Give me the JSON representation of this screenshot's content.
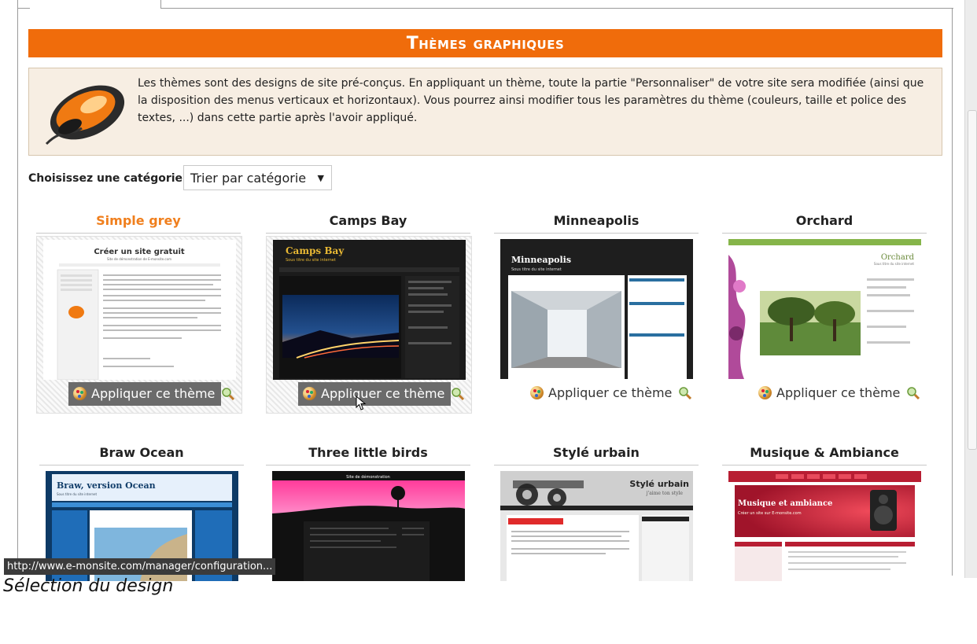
{
  "banner": {
    "title": "Thèmes graphiques"
  },
  "intro": {
    "text": "Les thèmes sont des designs de site pré-conçus. En appliquant un thème, toute la partie \"Personnaliser\" de votre site sera modifiée (ainsi que la disposition des menus verticaux et horizontaux). Vous pourrez ainsi modifier tous les paramètres du thème (couleurs, taille et police des textes, ...) dans cette partie après l'avoir appliqué."
  },
  "category": {
    "label": "Choisissez une catégorie :",
    "selected": "Trier par catégorie"
  },
  "apply_label": "Appliquer ce thème",
  "colors": {
    "accent": "#f06c0b",
    "highlight_title": "#f07f1d"
  },
  "themes": [
    {
      "name": "Simple grey",
      "preview_title": "Créer un site gratuit",
      "preview_sub": "Site de démonstration de E-monsite.com"
    },
    {
      "name": "Camps Bay",
      "preview_title": "Camps Bay",
      "preview_sub": "Sous titre du site internet"
    },
    {
      "name": "Minneapolis",
      "preview_title": "Minneapolis",
      "preview_sub": "Sous titre du site internet"
    },
    {
      "name": "Orchard",
      "preview_title": "Orchard",
      "preview_sub": "Sous titre du site internet"
    },
    {
      "name": "Braw Ocean",
      "preview_title": "Braw, version Ocean",
      "preview_sub": "Sous titre du site internet"
    },
    {
      "name": "Three little birds",
      "preview_title": "Site de démonstration",
      "preview_sub": ""
    },
    {
      "name": "Stylé urbain",
      "preview_title": "Stylé urbain",
      "preview_sub": "j'aime ton style"
    },
    {
      "name": "Musique & Ambiance",
      "preview_title": "Musique et ambiance",
      "preview_sub": "Créer un site sur E-monsite.com"
    }
  ],
  "status_url": "http://www.e-monsite.com/manager/configuration...",
  "caption": "Sélection du design"
}
